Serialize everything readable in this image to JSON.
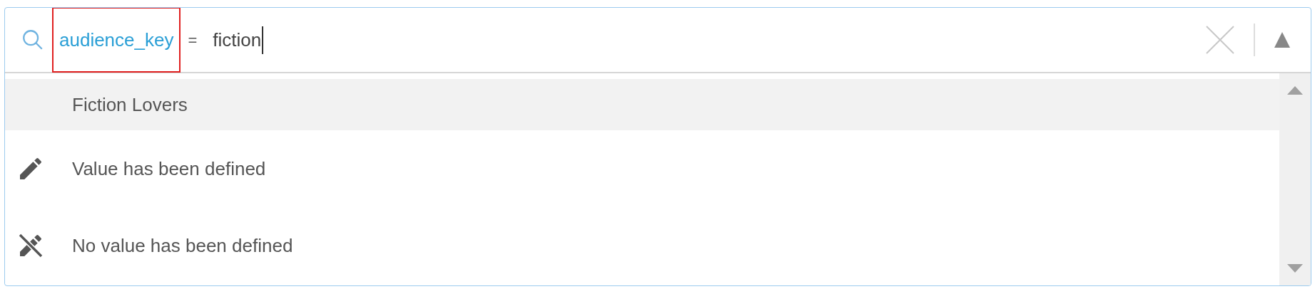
{
  "search": {
    "key": "audience_key",
    "key_highlighted": true,
    "operator": "=",
    "value": "fiction"
  },
  "suggestions": [
    {
      "kind": "value",
      "label": "Fiction Lovers",
      "selected": true
    },
    {
      "kind": "defined",
      "label": "Value has been defined",
      "selected": false
    },
    {
      "kind": "undefined",
      "label": "No value has been defined",
      "selected": false
    }
  ]
}
